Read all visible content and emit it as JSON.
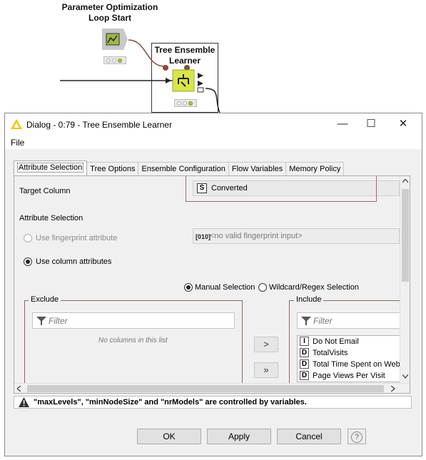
{
  "canvas": {
    "loop_start_title": "Parameter Optimization Loop Start",
    "learner_title": "Tree Ensemble Learner"
  },
  "dialog": {
    "title": "Dialog - 0:79 - Tree Ensemble Learner",
    "menu_file": "File",
    "tabs": [
      "Attribute Selection",
      "Tree Options",
      "Ensemble Configuration",
      "Flow Variables",
      "Memory Policy"
    ],
    "target_column_label": "Target Column",
    "target_column_value": "Converted",
    "target_column_type": "S",
    "attribute_selection_label": "Attribute Selection",
    "fingerprint_option": "Use fingerprint attribute",
    "fingerprint_value": "<no valid fingerprint input>",
    "fingerprint_type": "[010]",
    "column_attributes_option": "Use column attributes",
    "manual_selection": "Manual Selection",
    "wildcard_selection": "Wildcard/Regex Selection",
    "exclude_title": "Exclude",
    "include_title": "Include",
    "filter_placeholder": "Filter",
    "no_columns": "No columns in this list",
    "move_right": ">",
    "move_all_right": "»",
    "include_items": [
      {
        "type": "I",
        "name": "Do Not Email"
      },
      {
        "type": "D",
        "name": "TotalVisits"
      },
      {
        "type": "D",
        "name": "Total Time Spent on Website"
      },
      {
        "type": "D",
        "name": "Page Views Per Visit"
      }
    ],
    "warning_text": "\"maxLevels\", \"minNodeSize\" and \"nrModels\" are controlled by variables.",
    "ok": "OK",
    "apply": "Apply",
    "cancel": "Cancel",
    "help": "?"
  }
}
